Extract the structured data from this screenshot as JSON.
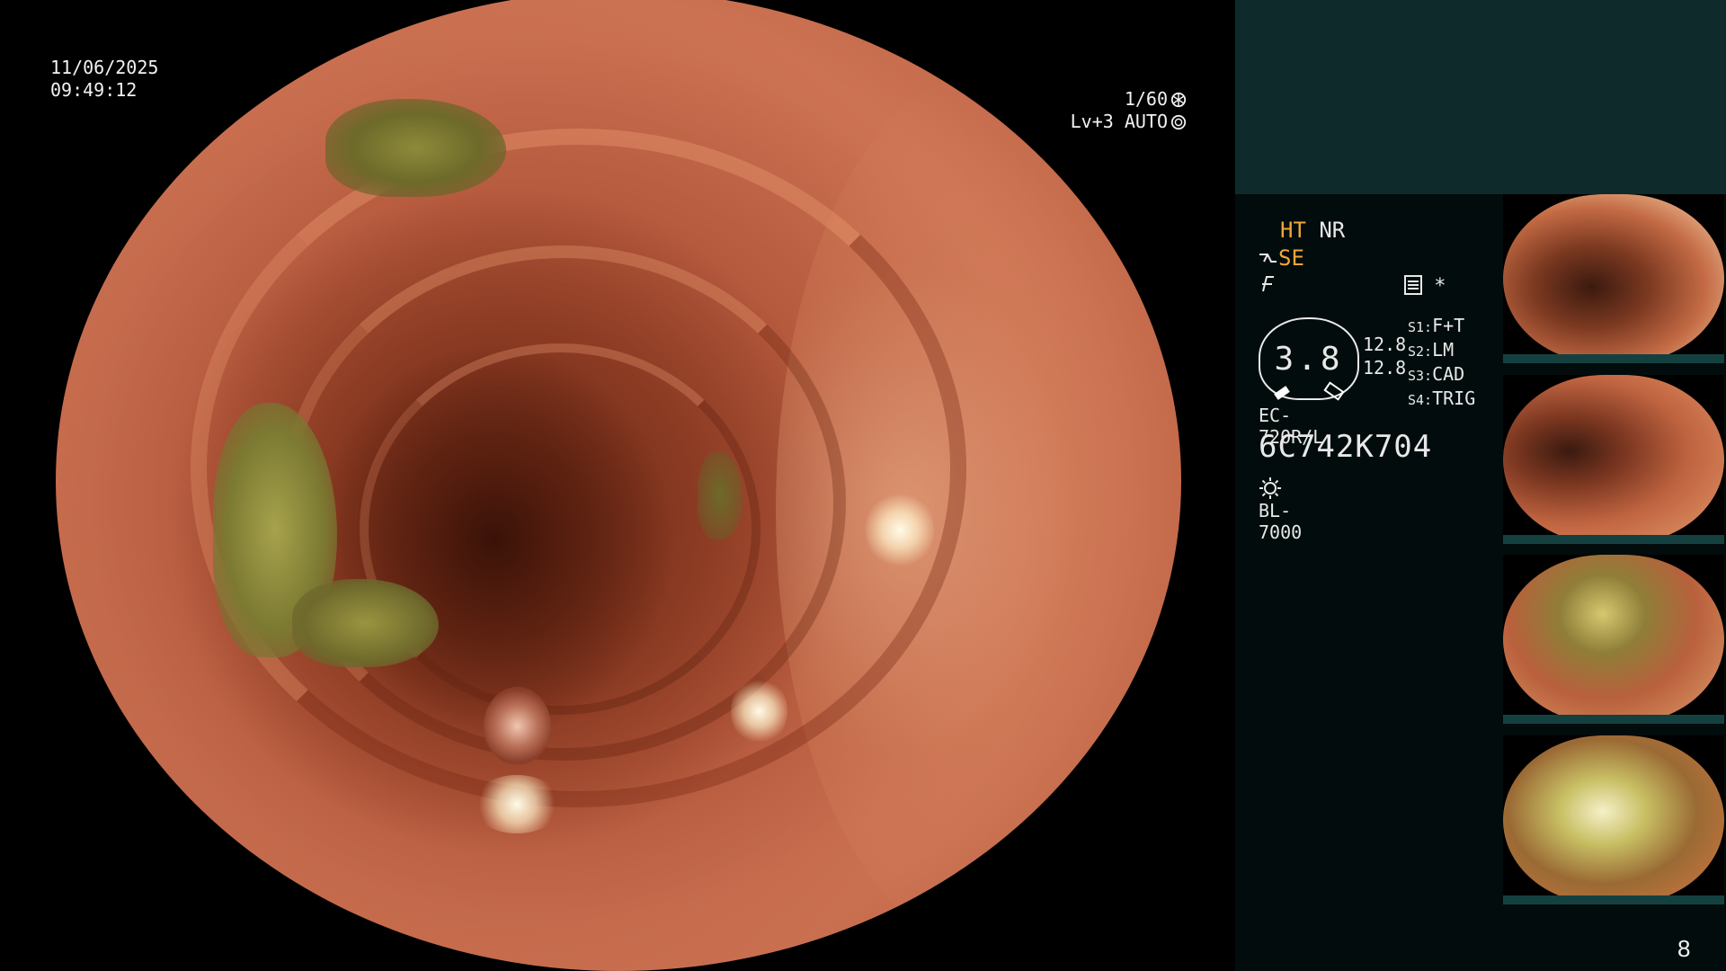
{
  "overlay": {
    "date": "11/06/2025",
    "time": "09:49:12",
    "shutter": "1/60",
    "iris": "Lv+3 AUTO"
  },
  "panel": {
    "ht": "HT",
    "nr": "NR",
    "se": "SE",
    "gauge_value": "3.8",
    "gauge_num_1": "12.8",
    "gauge_num_2": "12.8",
    "switches": [
      {
        "key": "S1:",
        "value": "F+T"
      },
      {
        "key": "S2:",
        "value": "LM"
      },
      {
        "key": "S3:",
        "value": "CAD"
      },
      {
        "key": "S4:",
        "value": "TRIG"
      }
    ],
    "scope_model": "EC-720R/L",
    "scope_serial": "6C742K704",
    "light_source": "BL-7000",
    "mode_star": "*"
  },
  "thumbnails": [
    "capture-1",
    "capture-2",
    "capture-3",
    "capture-4"
  ],
  "page_number": "8",
  "colors": {
    "accent": "#f0a638",
    "panel_top": "#0e2a2a",
    "panel_bg": "#020c0c"
  },
  "icons": [
    "shutter-icon",
    "iris-icon",
    "scope-icon",
    "filter-icon",
    "menu-icon",
    "sun-icon"
  ]
}
